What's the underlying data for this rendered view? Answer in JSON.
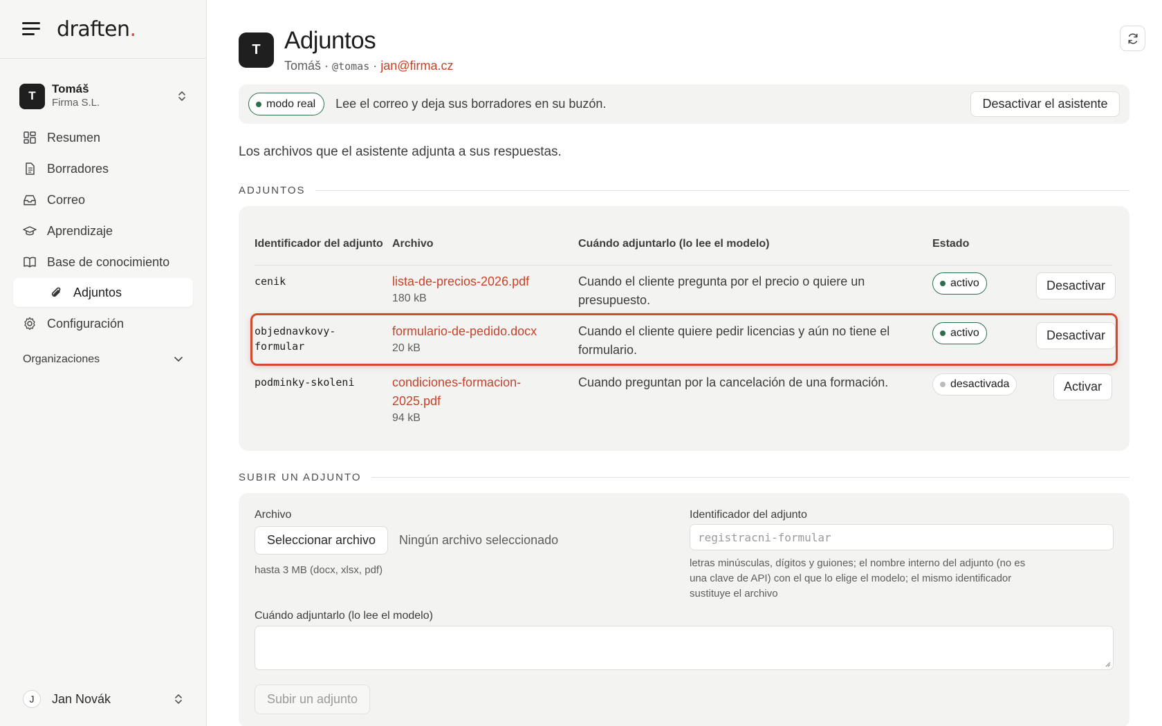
{
  "brand": {
    "name": "draften",
    "dot": "."
  },
  "org": {
    "initial": "T",
    "name": "Tomáš",
    "company": "Firma S.L."
  },
  "nav": {
    "items": [
      {
        "label": "Resumen",
        "icon": "dashboard-icon"
      },
      {
        "label": "Borradores",
        "icon": "document-icon"
      },
      {
        "label": "Correo",
        "icon": "inbox-icon"
      },
      {
        "label": "Aprendizaje",
        "icon": "graduation-cap-icon"
      },
      {
        "label": "Base de conocimiento",
        "icon": "book-icon"
      }
    ],
    "sub_active": {
      "label": "Adjuntos",
      "icon": "paperclip-icon"
    },
    "settings": {
      "label": "Configuración",
      "icon": "gear-icon"
    },
    "section": "Organizaciones"
  },
  "user": {
    "initial": "J",
    "name": "Jan Novák"
  },
  "header": {
    "initial": "T",
    "title": "Adjuntos",
    "name": "Tomáš",
    "sep1": "·",
    "handle": "@tomas",
    "sep2": "·",
    "email": "jan@firma.cz"
  },
  "banner": {
    "mode": "modo real",
    "text": "Lee el correo y deja sus borradores en su buzón.",
    "button": "Desactivar el asistente"
  },
  "intro": "Los archivos que el asistente adjunta a sus respuestas.",
  "attachments": {
    "section_title": "ADJUNTOS",
    "columns": {
      "ident": "Identificador del adjunto",
      "file": "Archivo",
      "when": "Cuándo adjuntarlo (lo lee el modelo)",
      "status": "Estado"
    },
    "rows": [
      {
        "ident": "cenik",
        "file": "lista-de-precios-2026.pdf",
        "size": "180 kB",
        "when": "Cuando el cliente pregunta por el precio o quiere un presupuesto.",
        "status": "activo",
        "action": "Desactivar"
      },
      {
        "ident": "objednavkovy-formular",
        "file": "formulario-de-pedido.docx",
        "size": "20 kB",
        "when": "Cuando el cliente quiere pedir licencias y aún no tiene el formulario.",
        "status": "activo",
        "action": "Desactivar"
      },
      {
        "ident": "podminky-skoleni",
        "file": "condiciones-formacion-2025.pdf",
        "size": "94 kB",
        "when": "Cuando preguntan por la cancelación de una formación.",
        "status": "desactivada",
        "action": "Activar"
      }
    ]
  },
  "upload": {
    "section_title": "SUBIR UN ADJUNTO",
    "file_label": "Archivo",
    "file_button": "Seleccionar archivo",
    "no_file": "Ningún archivo seleccionado",
    "file_hint": "hasta 3 MB (docx, xlsx, pdf)",
    "ident_label": "Identificador del adjunto",
    "ident_placeholder": "registracni-formular",
    "ident_hint": "letras minúsculas, dígitos y guiones; el nombre interno del adjunto (no es una clave de API) con el que lo elige el modelo; el mismo identificador sustituye el archivo",
    "when_label": "Cuándo adjuntarlo (lo lee el modelo)",
    "submit": "Subir un adjunto"
  },
  "colors": {
    "accent": "#c6432a",
    "active_green": "#2d6e4c",
    "highlight": "#d24a2e"
  }
}
